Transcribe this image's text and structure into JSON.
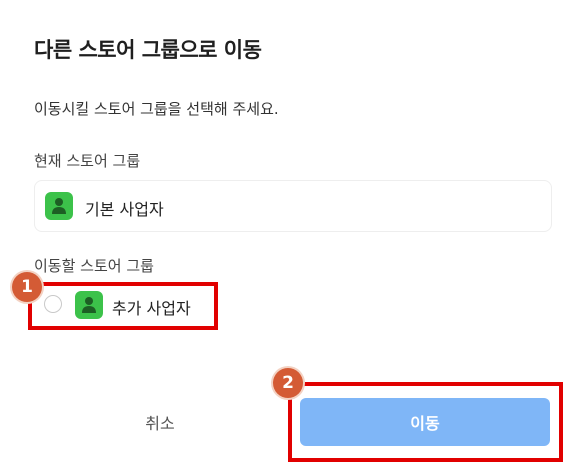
{
  "dialog": {
    "title": "다른 스토어 그룹으로 이동",
    "description": "이동시킬 스토어 그룹을 선택해 주세요."
  },
  "current_group": {
    "label": "현재 스토어 그룹",
    "name": "기본 사업자",
    "icon": "store-user-icon"
  },
  "target_group": {
    "label": "이동할 스토어 그룹",
    "options": [
      {
        "name": "추가 사업자",
        "icon": "store-user-icon",
        "selected": false
      }
    ]
  },
  "annotations": [
    {
      "number": "1"
    },
    {
      "number": "2"
    }
  ],
  "buttons": {
    "cancel_label": "취소",
    "move_label": "이동"
  },
  "colors": {
    "store_icon": "#3cc24a",
    "move_button": "#7fb6f7",
    "highlight": "#e10000",
    "badge": "#d45b35"
  }
}
